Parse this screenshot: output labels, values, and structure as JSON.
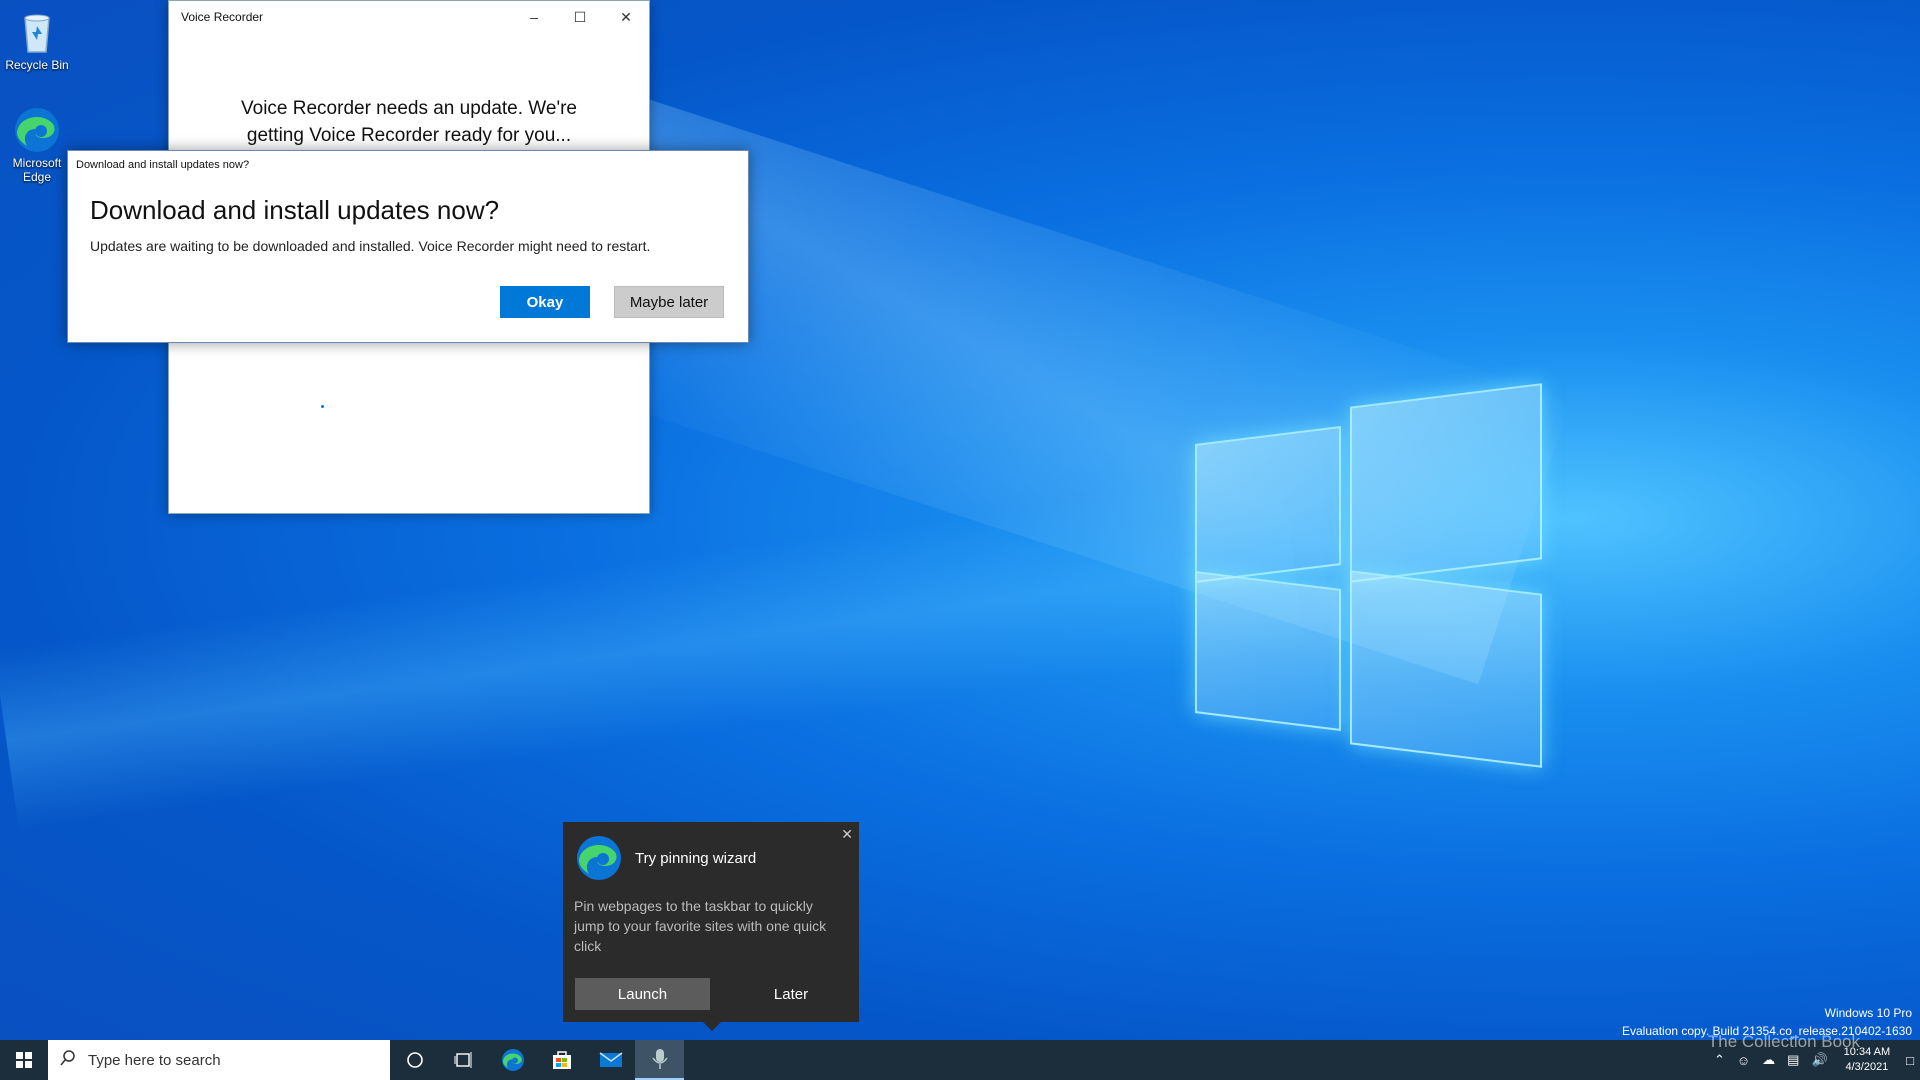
{
  "desktop": {
    "icons": [
      {
        "label": "Recycle Bin"
      },
      {
        "label": "Microsoft Edge"
      }
    ]
  },
  "voice_recorder": {
    "title": "Voice Recorder",
    "message": "Voice Recorder needs an update. We're getting Voice Recorder ready for you..."
  },
  "dialog": {
    "title": "Download and install updates now?",
    "heading": "Download and install updates now?",
    "body": "Updates are waiting to be downloaded and installed. Voice Recorder might need to restart.",
    "okay_label": "Okay",
    "maybe_later_label": "Maybe later"
  },
  "toast": {
    "title": "Try pinning wizard",
    "body": "Pin webpages to the taskbar to quickly jump to your favorite sites with one quick click",
    "launch_label": "Launch",
    "later_label": "Later"
  },
  "watermark": {
    "edition": "Windows 10 Pro",
    "build": "Evaluation copy. Build 21354.co_release.210402-1630",
    "overlay": "The Collection Book"
  },
  "taskbar": {
    "search_placeholder": "Type here to search",
    "time": "10:34 AM",
    "date": "4/3/2021"
  },
  "colors": {
    "accent": "#0078d7",
    "taskbar": "#1c2d3c",
    "toast_bg": "#2b2b2b"
  }
}
